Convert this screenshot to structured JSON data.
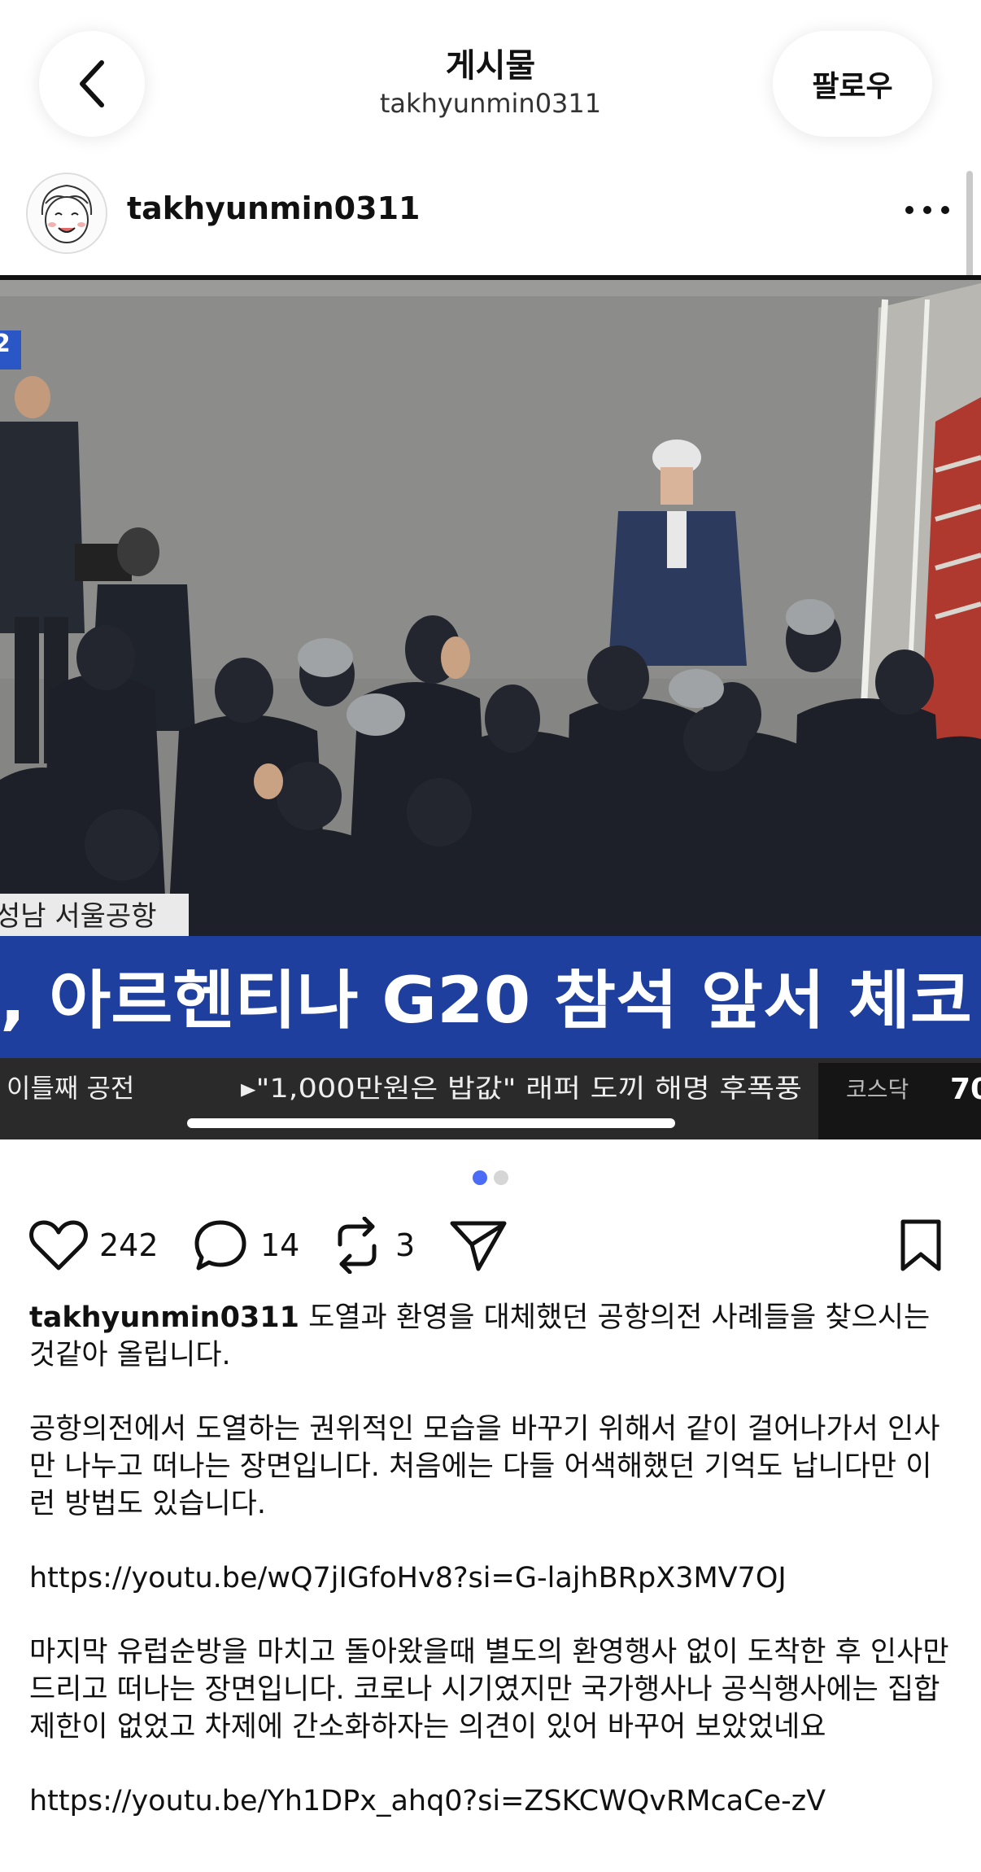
{
  "header": {
    "title": "게시물",
    "subtitle": "takhyunmin0311",
    "follow_label": "팔로우"
  },
  "author": {
    "username": "takhyunmin0311"
  },
  "media": {
    "ticker_left": "이틀째 공전",
    "ticker_mid": "▸\"1,000만원은 밥값\" 래퍼 도끼 해명 후폭풍",
    "ticker_right_label": "코스닥",
    "ticker_right_value": "70",
    "location_label": "성남 서울공항",
    "headline": ", 아르헨티나 G20 참석 앞서 체코",
    "corner_tag": "2",
    "carousel_pages": 2,
    "carousel_current": 1
  },
  "actions": {
    "likes": "242",
    "comments": "14",
    "reposts": "3"
  },
  "caption": {
    "username": "takhyunmin0311",
    "intro": " 도열과 환영을 대체했던 공항의전 사례들을 찾으시는 것같아 올립니다.",
    "para1": "공항의전에서 도열하는 권위적인 모습을 바꾸기 위해서 같이 걸어나가서 인사만 나누고 떠나는 장면입니다. 처음에는 다들 어색해했던 기억도 납니다만 이런 방법도 있습니다.",
    "link1": "https://youtu.be/wQ7jIGfoHv8?si=G-lajhBRpX3MV7OJ",
    "para2": "마지막 유럽순방을 마치고 돌아왔을때 별도의 환영행사 없이 도착한 후 인사만 드리고 떠나는 장면입니다. 코로나 시기였지만 국가행사나 공식행사에는 집합제한이 없었고 차제에 간소화하자는 의견이 있어 바꾸어 보았었네요",
    "link2": "https://youtu.be/Yh1DPx_ahq0?si=ZSKCWQvRMcaCe-zV"
  },
  "colors": {
    "accent": "#4a6cf7",
    "banner_blue": "#1f3f9e",
    "ticker_bg": "#2a2a2a"
  }
}
